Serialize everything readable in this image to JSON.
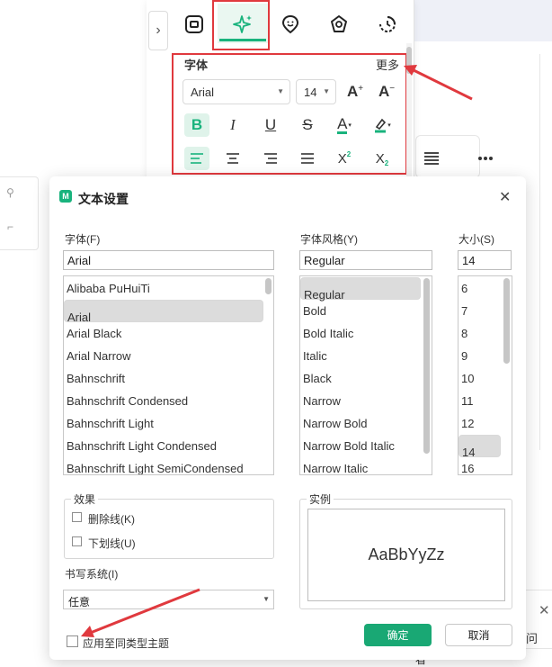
{
  "panel": {
    "section_title": "字体",
    "more_label": "更多",
    "font_family": "Arial",
    "font_size": "14",
    "increase_label": "A",
    "decrease_label": "A",
    "bold_label": "B",
    "italic_label": "I",
    "underline_label": "U",
    "strike_label": "S",
    "color_label": "A",
    "superscript_label": "X",
    "superscript_mark": "2",
    "subscript_label": "X",
    "subscript_mark": "2",
    "accent_color": "#19b37d",
    "highlight_color": "#e0393e"
  },
  "dialog": {
    "title": "文本设置",
    "font_label": "字体(F)",
    "font_value": "Arial",
    "font_list": [
      "Alibaba PuHuiTi",
      "Arial",
      "Arial Black",
      "Arial Narrow",
      "Bahnschrift",
      "Bahnschrift Condensed",
      "Bahnschrift Light",
      "Bahnschrift Light Condensed",
      "Bahnschrift Light SemiCondensed"
    ],
    "style_label": "字体风格(Y)",
    "style_value": "Regular",
    "style_list": [
      "Regular",
      "Bold",
      "Bold Italic",
      "Italic",
      "Black",
      "Narrow",
      "Narrow Bold",
      "Narrow Bold Italic",
      "Narrow Italic"
    ],
    "size_label": "大小(S)",
    "size_value": "14",
    "size_list": [
      "6",
      "7",
      "8",
      "9",
      "10",
      "11",
      "12",
      "14",
      "16"
    ],
    "effects_label": "效果",
    "strikethrough_label": "删除线(K)",
    "underline_label": "下划线(U)",
    "sample_label": "实例",
    "sample_text": "AaBbYyZz",
    "script_label": "书写系统(I)",
    "script_value": "任意",
    "apply_label": "应用至同类型主题",
    "ok_label": "确定",
    "cancel_label": "取消"
  },
  "background": {
    "side_text_1": "问",
    "side_text_2": "看"
  }
}
